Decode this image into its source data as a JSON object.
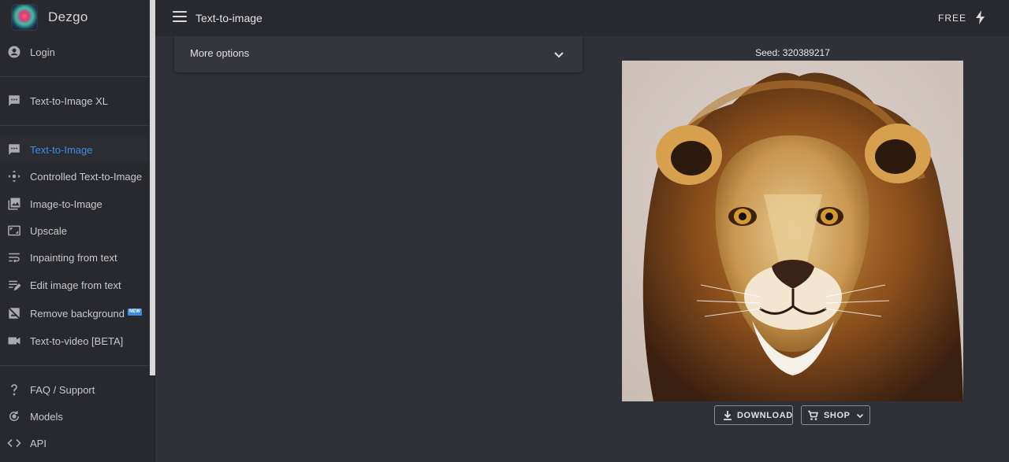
{
  "brand": {
    "name": "Dezgo"
  },
  "sidebar": {
    "login": {
      "label": "Login",
      "icon": "account-circle-icon"
    },
    "xl": {
      "label": "Text-to-Image XL",
      "icon": "chat-dots-icon"
    },
    "tools": [
      {
        "label": "Text-to-Image",
        "icon": "chat-dots-icon",
        "active": true
      },
      {
        "label": "Controlled Text-to-Image",
        "icon": "move-arrows-icon"
      },
      {
        "label": "Image-to-Image",
        "icon": "photo-library-icon"
      },
      {
        "label": "Upscale",
        "icon": "aspect-ratio-icon"
      },
      {
        "label": "Inpainting from text",
        "icon": "wrap-text-icon"
      },
      {
        "label": "Edit image from text",
        "icon": "edit-note-icon"
      },
      {
        "label": "Remove background",
        "icon": "hide-image-icon",
        "badge": "NEW"
      },
      {
        "label": "Text-to-video [BETA]",
        "icon": "videocam-icon"
      }
    ],
    "help": [
      {
        "label": "FAQ / Support",
        "icon": "question-mark-icon"
      },
      {
        "label": "Models",
        "icon": "model-cycle-icon"
      },
      {
        "label": "API",
        "icon": "code-icon"
      }
    ]
  },
  "topbar": {
    "title": "Text-to-image",
    "plan": "FREE"
  },
  "main": {
    "options_label": "More options",
    "seed_label": "Seed: 320389217",
    "download_label": "DOWNLOAD",
    "shop_label": "SHOP"
  },
  "colors": {
    "accent": "#3b8ce6",
    "background": "#2f3038",
    "sidebar": "#28292e"
  }
}
